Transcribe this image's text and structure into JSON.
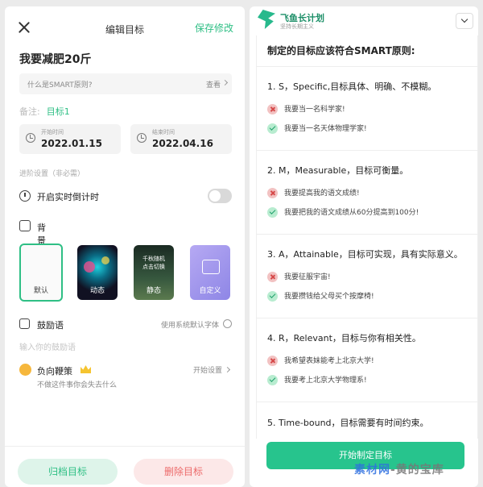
{
  "left": {
    "title": "编辑目标",
    "save": "保存修改",
    "goal": "我要减肥20斤",
    "smart_question": "什么是SMART原则?",
    "smart_view": "查看",
    "note_label": "备注:",
    "note_value": "目标1",
    "start_label": "开始时间",
    "start_date": "2022.01.15",
    "end_label": "结束时间",
    "end_date": "2022.04.16",
    "advanced": "进阶设置（非必需）",
    "realtime_countdown": "开启实时倒计时",
    "background": "背景",
    "bg_options": [
      "默认",
      "动态",
      "静态",
      "自定义"
    ],
    "bg_static_text": [
      "千秋随机",
      "点击切换"
    ],
    "encourage": "鼓励语",
    "use_system_font": "使用系统默认字体",
    "encourage_placeholder": "输入你的鼓励语",
    "negative_title": "负向鞭策",
    "negative_sub": "不做这件事你会失去什么",
    "negative_action": "开始设置",
    "archive": "归档目标",
    "delete": "删除目标"
  },
  "right": {
    "brand": "飞鱼长计划",
    "tagline": "坚持长期主义",
    "heading": "制定的目标应该符合SMART原则:",
    "principles": [
      {
        "title": "1. S，Specific,目标具体、明确、不模糊。",
        "bad": "我要当一名科学家!",
        "good": "我要当一名天体物理学家!"
      },
      {
        "title": "2. M，Measurable，目标可衡量。",
        "bad": "我要提高我的语文成绩!",
        "good": "我要把我的语文成绩从60分提高到100分!"
      },
      {
        "title": "3. A，Attainable，目标可实现，具有实际意义。",
        "bad": "我要征服宇宙!",
        "good": "我要攒钱给父母买个按摩椅!"
      },
      {
        "title": "4. R，Relevant，目标与你有相关性。",
        "bad": "我希望表妹能考上北京大学!",
        "good": "我要考上北京大学物理系!"
      },
      {
        "title": "5. Time-bound，目标需要有时间约束。"
      }
    ],
    "start_button": "开始制定目标"
  },
  "watermark": {
    "blue": "素材网",
    "gray": "-黄的宝库"
  }
}
